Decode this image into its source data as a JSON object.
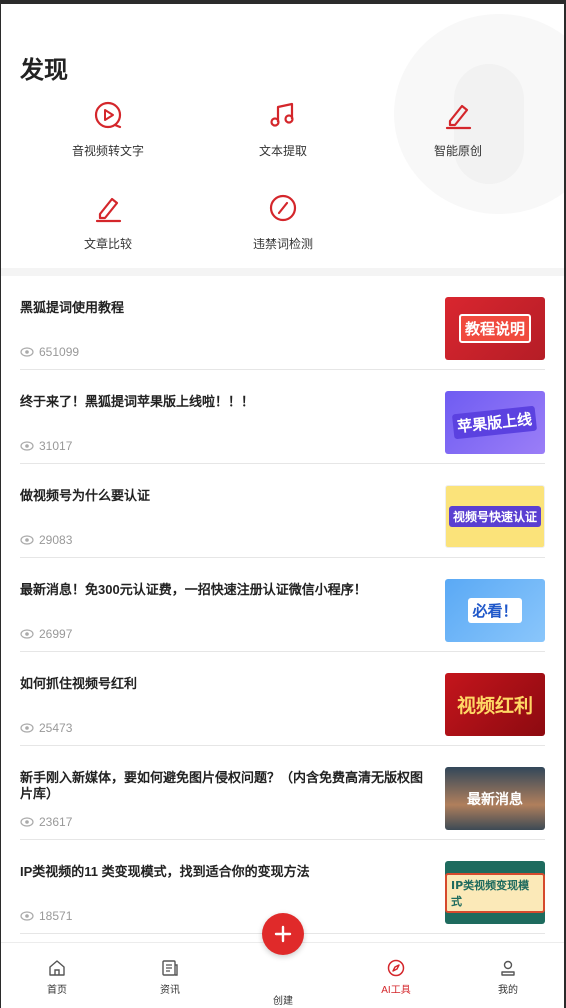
{
  "page": {
    "title": "发现"
  },
  "tools": [
    {
      "label": "音视频转文字",
      "icon": "play-circle-icon"
    },
    {
      "label": "文本提取",
      "icon": "music-note-icon"
    },
    {
      "label": "智能原创",
      "icon": "pen-icon"
    },
    {
      "label": "文章比较",
      "icon": "pen-icon"
    },
    {
      "label": "违禁词检测",
      "icon": "forbidden-icon"
    }
  ],
  "articles": [
    {
      "title": "黑狐提词使用教程",
      "views": "651099",
      "thumb_text": "教程说明"
    },
    {
      "title": "终于来了！黑狐提词苹果版上线啦！！！",
      "views": "31017",
      "thumb_text": "苹果版上线"
    },
    {
      "title": "做视频号为什么要认证",
      "views": "29083",
      "thumb_text": "视频号快速认证"
    },
    {
      "title": "最新消息！免300元认证费，一招快速注册认证微信小程序！",
      "views": "26997",
      "thumb_text": "必看！"
    },
    {
      "title": "如何抓住视频号红利",
      "views": "25473",
      "thumb_text": "视频红利"
    },
    {
      "title": "新手刚入新媒体，要如何避免图片侵权问题？（内含免费高清无版权图片库）",
      "views": "23617",
      "thumb_text": "最新消息"
    },
    {
      "title": "IP类视频的11 类变现模式，找到适合你的变现方法",
      "views": "18571",
      "thumb_text": "IP类视频变现模式"
    }
  ],
  "tabbar": {
    "home": "首页",
    "news": "资讯",
    "create": "创建",
    "ai_tools": "AI工具",
    "mine": "我的"
  },
  "colors": {
    "accent": "#d4262b"
  }
}
